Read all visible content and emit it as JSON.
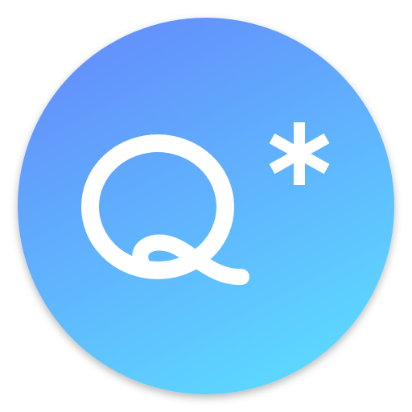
{
  "app_icon": {
    "name": "Q*",
    "gradient_start": "#6393FC",
    "gradient_end": "#5CD6FF",
    "glyph_color": "#FFFFFF",
    "glyphs": [
      "Q-letter",
      "asterisk"
    ]
  }
}
